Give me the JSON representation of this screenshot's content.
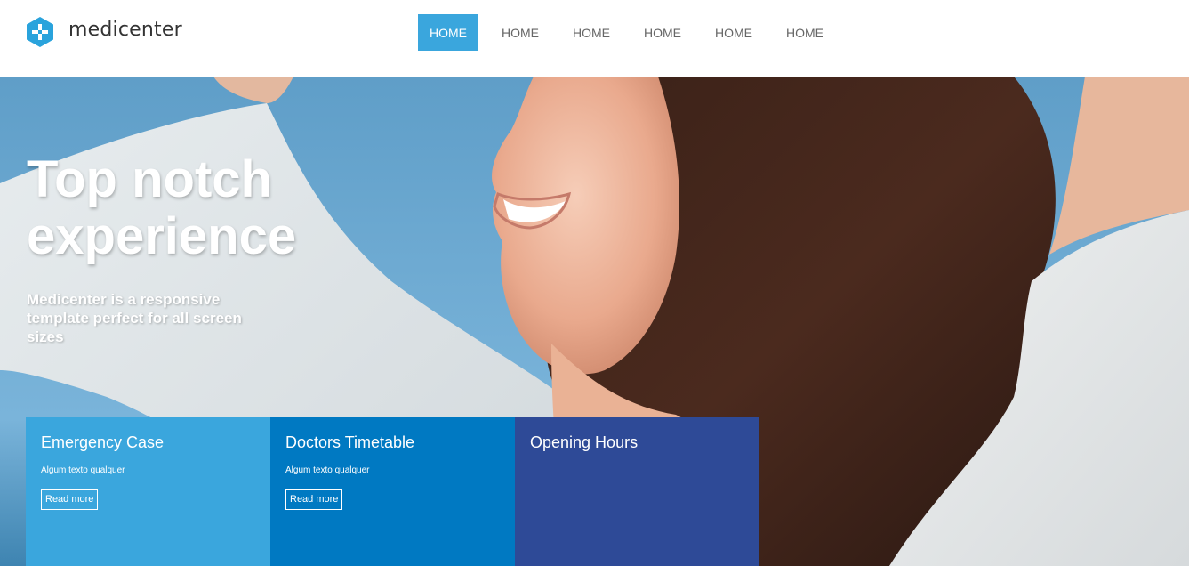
{
  "brand": {
    "name": "medicenter",
    "icon": "hexagon-plus-icon",
    "color": "#2aa3dc"
  },
  "nav": {
    "items": [
      {
        "label": "HOME",
        "active": true
      },
      {
        "label": "HOME",
        "active": false
      },
      {
        "label": "HOME",
        "active": false
      },
      {
        "label": "HOME",
        "active": false
      },
      {
        "label": "HOME",
        "active": false
      },
      {
        "label": "HOME",
        "active": false
      }
    ],
    "active_color": "#3aa6dd"
  },
  "hero": {
    "title": "Top notch experience",
    "subtitle": "Medicenter is a responsive template perfect for all screen sizes"
  },
  "boxes": [
    {
      "title": "Emergency Case",
      "text": "Algum texto qualquer",
      "button": "Read more",
      "color": "#3aa6dd"
    },
    {
      "title": "Doctors Timetable",
      "text": "Algum texto qualquer",
      "button": "Read more",
      "color": "#0079c2"
    },
    {
      "title": "Opening Hours",
      "color": "#2e4a97"
    }
  ]
}
